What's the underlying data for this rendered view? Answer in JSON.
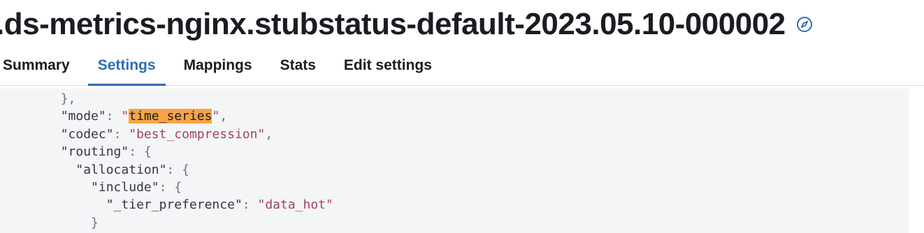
{
  "header": {
    "title": ".ds-metrics-nginx.stubstatus-default-2023.05.10-000002",
    "discover_icon": "compass-icon"
  },
  "tabs": [
    {
      "label": "Summary",
      "active": false
    },
    {
      "label": "Settings",
      "active": true
    },
    {
      "label": "Mappings",
      "active": false
    },
    {
      "label": "Stats",
      "active": false
    },
    {
      "label": "Edit settings",
      "active": false
    }
  ],
  "code": {
    "lines": [
      {
        "indent": "        ",
        "parts": [
          {
            "t": "},",
            "c": "punct"
          }
        ]
      },
      {
        "indent": "        ",
        "parts": [
          {
            "t": "\"mode\"",
            "c": "key"
          },
          {
            "t": ": ",
            "c": "punct"
          },
          {
            "t": "\"",
            "c": "str"
          },
          {
            "t": "time_series",
            "c": "hl"
          },
          {
            "t": "\"",
            "c": "str"
          },
          {
            "t": ",",
            "c": "punct"
          }
        ]
      },
      {
        "indent": "        ",
        "parts": [
          {
            "t": "\"codec\"",
            "c": "key"
          },
          {
            "t": ": ",
            "c": "punct"
          },
          {
            "t": "\"best_compression\"",
            "c": "str"
          },
          {
            "t": ",",
            "c": "punct"
          }
        ]
      },
      {
        "indent": "        ",
        "parts": [
          {
            "t": "\"routing\"",
            "c": "key"
          },
          {
            "t": ": {",
            "c": "punct"
          }
        ]
      },
      {
        "indent": "          ",
        "parts": [
          {
            "t": "\"allocation\"",
            "c": "key"
          },
          {
            "t": ": {",
            "c": "punct"
          }
        ]
      },
      {
        "indent": "            ",
        "parts": [
          {
            "t": "\"include\"",
            "c": "key"
          },
          {
            "t": ": {",
            "c": "punct"
          }
        ]
      },
      {
        "indent": "              ",
        "parts": [
          {
            "t": "\"_tier_preference\"",
            "c": "key"
          },
          {
            "t": ": ",
            "c": "punct"
          },
          {
            "t": "\"data_hot\"",
            "c": "str"
          }
        ]
      },
      {
        "indent": "            ",
        "parts": [
          {
            "t": "}",
            "c": "punct"
          }
        ]
      }
    ]
  },
  "colors": {
    "accent": "#2f6db3",
    "highlight": "#f6a444",
    "string": "#a4405f",
    "code_background": "#f4f5f7"
  }
}
